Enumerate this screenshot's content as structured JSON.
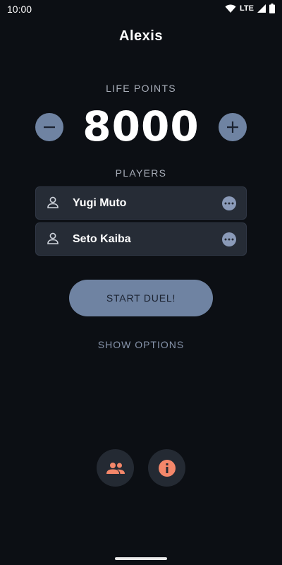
{
  "status_bar": {
    "time": "10:00",
    "network": "LTE",
    "icons": [
      "wifi-icon",
      "signal-icon",
      "battery-icon"
    ]
  },
  "app": {
    "title": "Alexis"
  },
  "life_points": {
    "label": "LIFE POINTS",
    "value": "8000",
    "decrement_icon": "minus-icon",
    "increment_icon": "plus-icon"
  },
  "players": {
    "label": "PLAYERS",
    "items": [
      {
        "name": "Yugi Muto",
        "icon": "person-icon",
        "menu_icon": "more-options-icon"
      },
      {
        "name": "Seto Kaiba",
        "icon": "person-icon",
        "menu_icon": "more-options-icon"
      }
    ]
  },
  "actions": {
    "start_duel": "START DUEL!",
    "show_options": "SHOW OPTIONS"
  },
  "bottom_bar": {
    "players_icon": "group-icon",
    "info_icon": "info-icon"
  },
  "colors": {
    "background": "#0c0f14",
    "accent": "#6f83a2",
    "card": "#262c36",
    "icon_accent": "#f4876a",
    "muted_text": "#a7adb8"
  }
}
